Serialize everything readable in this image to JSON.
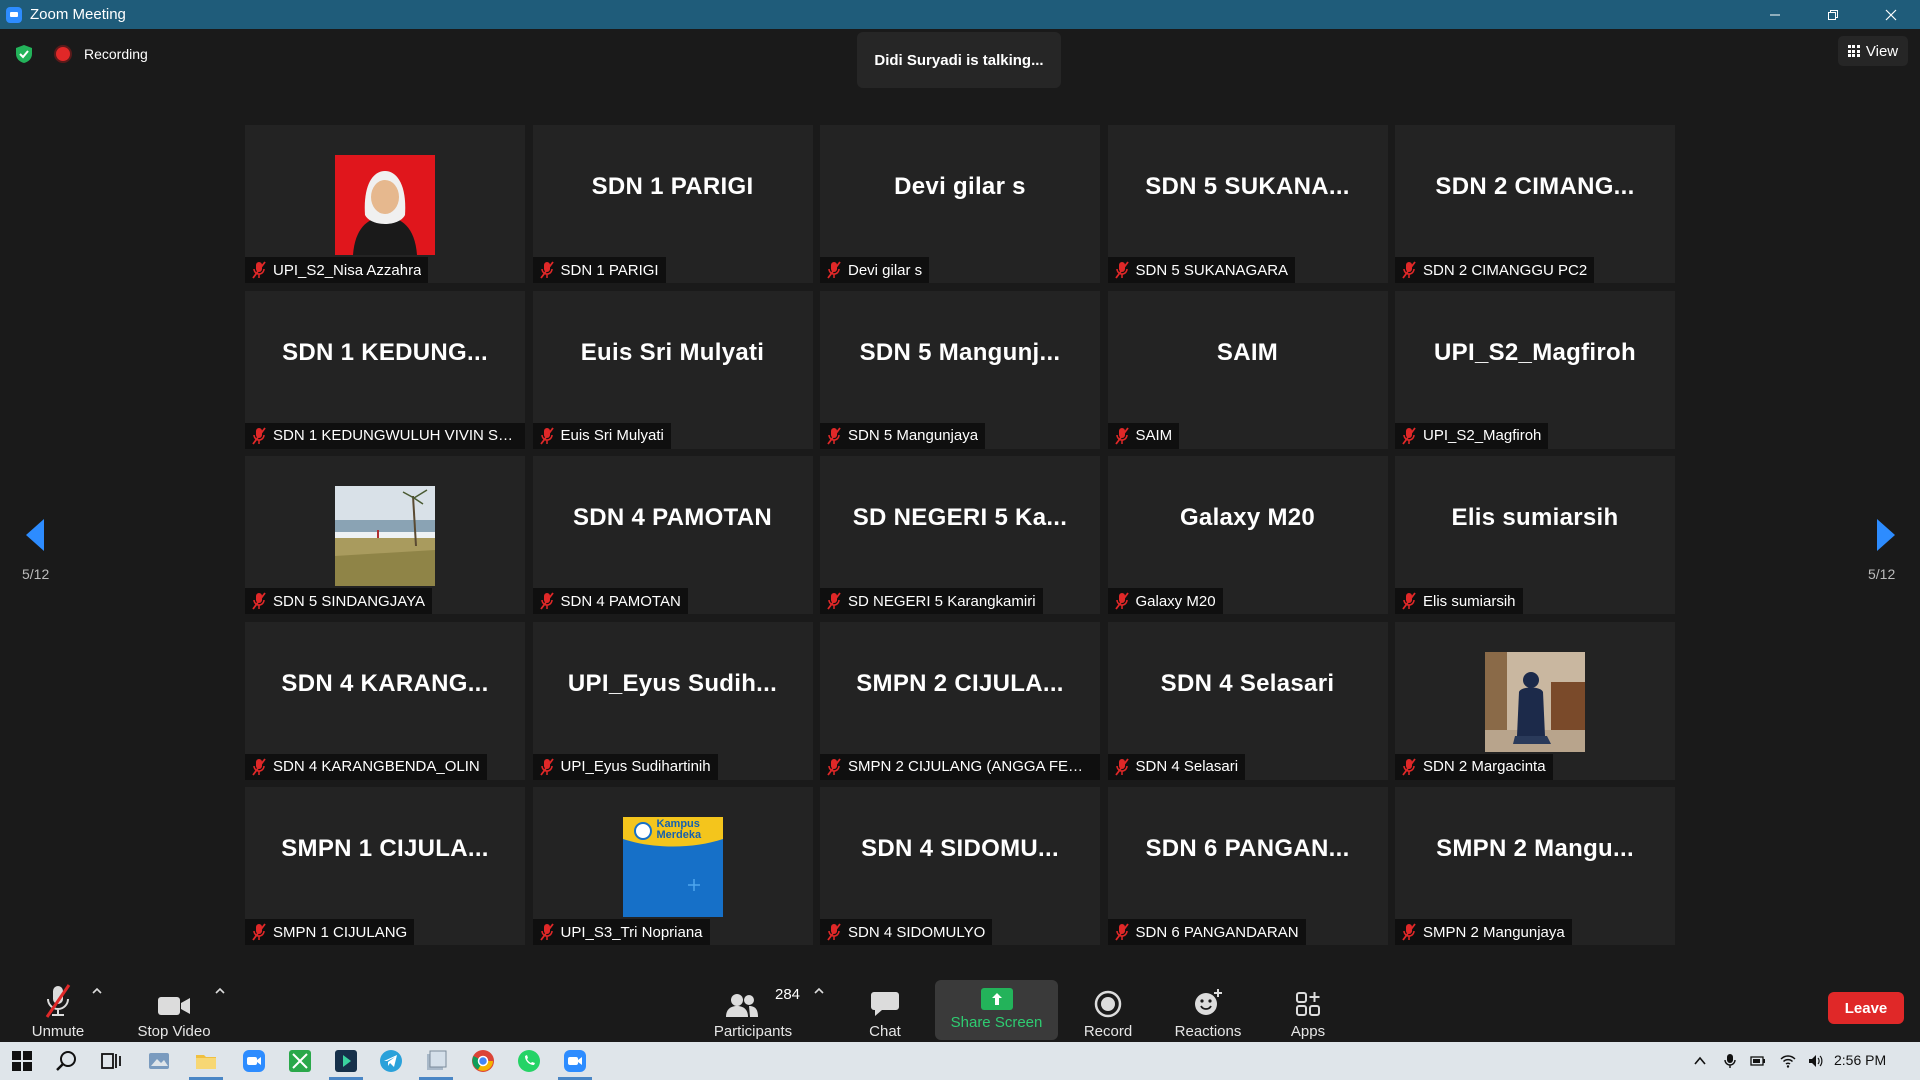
{
  "window": {
    "title": "Zoom Meeting"
  },
  "topbar": {
    "recording_label": "Recording",
    "talking_text": "Didi Suryadi is talking...",
    "view_label": "View"
  },
  "pagination": {
    "left": "5/12",
    "right": "5/12"
  },
  "tiles": [
    {
      "big": "",
      "name": "UPI_S2_Nisa Azzahra",
      "photo": "portrait-red-bg"
    },
    {
      "big": "SDN 1 PARIGI",
      "name": "SDN 1 PARIGI"
    },
    {
      "big": "Devi gilar s",
      "name": "Devi gilar s"
    },
    {
      "big": "SDN 5 SUKANA...",
      "name": "SDN 5 SUKANAGARA"
    },
    {
      "big": "SDN 2 CIMANG...",
      "name": "SDN 2 CIMANGGU PC2"
    },
    {
      "big": "SDN 1 KEDUNG...",
      "name": "SDN 1 KEDUNGWULUH VIVIN SO..."
    },
    {
      "big": "Euis Sri Mulyati",
      "name": "Euis Sri Mulyati"
    },
    {
      "big": "SDN 5 Mangunj...",
      "name": "SDN 5 Mangunjaya"
    },
    {
      "big": "SAIM",
      "name": "SAIM"
    },
    {
      "big": "UPI_S2_Magfiroh",
      "name": "UPI_S2_Magfiroh"
    },
    {
      "big": "",
      "name": "SDN 5 SINDANGJAYA",
      "photo": "beach"
    },
    {
      "big": "SDN 4 PAMOTAN",
      "name": "SDN 4 PAMOTAN"
    },
    {
      "big": "SD NEGERI 5 Ka...",
      "name": "SD NEGERI 5 Karangkamiri"
    },
    {
      "big": "Galaxy M20",
      "name": "Galaxy M20"
    },
    {
      "big": "Elis sumiarsih",
      "name": "Elis sumiarsih"
    },
    {
      "big": "SDN 4 KARANG...",
      "name": "SDN 4 KARANGBENDA_OLIN"
    },
    {
      "big": "UPI_Eyus Sudih...",
      "name": "UPI_Eyus Sudihartinih"
    },
    {
      "big": "SMPN 2 CIJULA...",
      "name": "SMPN 2 CIJULANG (ANGGA FEBRI..."
    },
    {
      "big": "SDN 4 Selasari",
      "name": "SDN 4 Selasari"
    },
    {
      "big": "",
      "name": "SDN 2 Margacinta",
      "photo": "room-person"
    },
    {
      "big": "SMPN 1 CIJULA...",
      "name": "SMPN 1 CIJULANG"
    },
    {
      "big": "",
      "name": "UPI_S3_Tri Nopriana",
      "photo": "kampus-merdeka"
    },
    {
      "big": "SDN 4 SIDOMU...",
      "name": "SDN 4 SIDOMULYO"
    },
    {
      "big": "SDN 6 PANGAN...",
      "name": "SDN 6 PANGANDARAN"
    },
    {
      "big": "SMPN 2 Mangu...",
      "name": "SMPN 2 Mangunjaya"
    }
  ],
  "kampus_logo": {
    "line1": "Kampus",
    "line2": "Merdeka"
  },
  "toolbar": {
    "unmute_label": "Unmute",
    "stop_video_label": "Stop Video",
    "participants_label": "Participants",
    "participants_count": "284",
    "chat_label": "Chat",
    "share_label": "Share Screen",
    "record_label": "Record",
    "reactions_label": "Reactions",
    "apps_label": "Apps",
    "leave_label": "Leave"
  },
  "taskbar": {
    "time": "2:56 PM"
  },
  "colors": {
    "accent": "#2d8cff",
    "leave": "#e02828",
    "share": "#23b35a",
    "titlebar": "#1f5c7a"
  }
}
